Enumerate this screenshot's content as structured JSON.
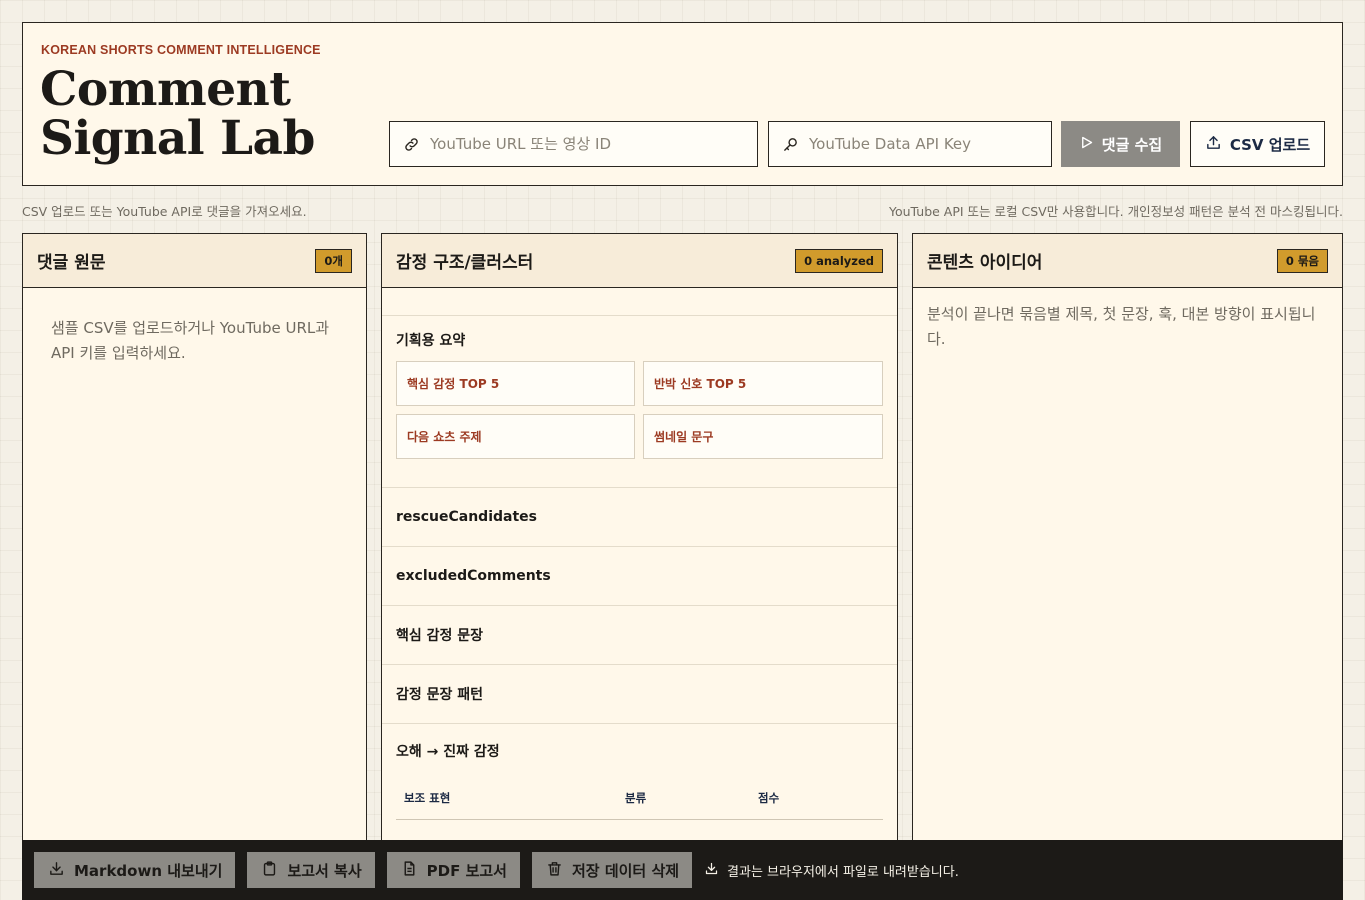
{
  "header": {
    "eyebrow": "KOREAN SHORTS COMMENT INTELLIGENCE",
    "title_line1": "Comment",
    "title_line2": "Signal Lab",
    "url_placeholder": "YouTube URL 또는 영상 ID",
    "key_placeholder": "YouTube Data API Key",
    "collect_label": "댓글 수집",
    "csv_label": "CSV 업로드"
  },
  "subbar": {
    "left": "CSV 업로드 또는 YouTube API로 댓글을 가져오세요.",
    "right": "YouTube API 또는 로컬 CSV만 사용합니다. 개인정보성 패턴은 분석 전 마스킹됩니다."
  },
  "panels": {
    "raw": {
      "title": "댓글 원문",
      "badge": "0개",
      "empty": "샘플 CSV를 업로드하거나 YouTube URL과 API 키를 입력하세요."
    },
    "emotion": {
      "title": "감정 구조/클러스터",
      "badge": "0 analyzed",
      "summary_title": "기획용 요약",
      "cards": [
        "핵심 감정 TOP 5",
        "반박 신호 TOP 5",
        "다음 쇼츠 주제",
        "썸네일 문구"
      ],
      "sections": [
        "rescueCandidates",
        "excludedComments",
        "핵심 감정 문장",
        "감정 문장 패턴",
        "오해 → 진짜 감정"
      ],
      "table_headers": [
        "보조 표현",
        "분류",
        "점수"
      ]
    },
    "ideas": {
      "title": "콘텐츠 아이디어",
      "badge": "0 묶음",
      "empty": "분석이 끝나면 묶음별 제목, 첫 문장, 훅, 대본 방향이 표시됩니다."
    }
  },
  "footer": {
    "markdown": "Markdown 내보내기",
    "copy": "보고서 복사",
    "pdf": "PDF 보고서",
    "delete": "저장 데이터 삭제",
    "note": "결과는 브라우저에서 파일로 내려받습니다."
  },
  "icons": {
    "url": "link-icon",
    "key": "key-icon",
    "collect": "play-icon",
    "csv": "upload-icon",
    "markdown": "download-icon",
    "copy": "clipboard-icon",
    "pdf": "document-icon",
    "delete": "trash-icon",
    "note": "download-icon"
  },
  "colors": {
    "accent_red": "#9c3a22",
    "badge_gold": "#d19b2c",
    "paper": "#fff8ea",
    "ink": "#1c1a17",
    "disabled_button": "#8c8a85"
  }
}
